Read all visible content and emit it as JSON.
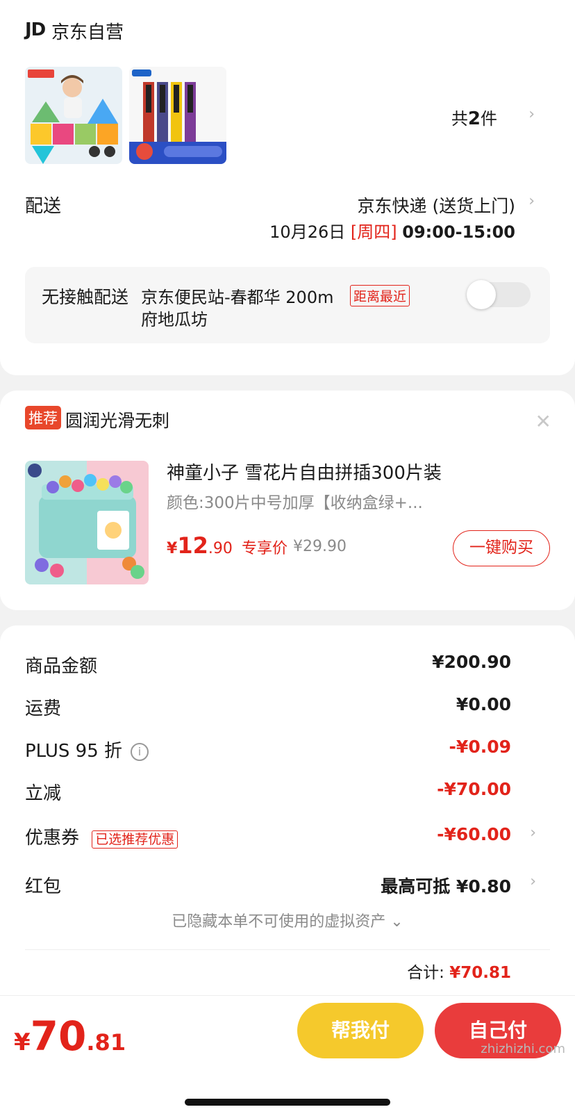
{
  "store": {
    "logo": "JD",
    "name": "京东自营"
  },
  "items_summary": {
    "prefix": "共",
    "count": "2",
    "suffix": "件"
  },
  "delivery": {
    "label": "配送",
    "method": "京东快递 (送货上门)",
    "date": "10月26日",
    "weekday": "[周四]",
    "time": "09:00-15:00"
  },
  "no_contact": {
    "label": "无接触配送",
    "station": "京东便民站-春都华 200m",
    "tag": "距离最近",
    "station_line2": "府地瓜坊"
  },
  "recommend": {
    "badge": "推荐",
    "title": "圆润光滑无刺",
    "product_name": "神童小子 雪花片自由拼插300片装",
    "spec": "颜色:300片中号加厚【收纳盒绿+...",
    "price_symbol": "¥",
    "price_int": "12",
    "price_dec": ".90",
    "price_label": "专享价",
    "original_price": "¥29.90",
    "buy_button": "一键购买"
  },
  "fees": {
    "goods": {
      "label": "商品金额",
      "value": "¥200.90"
    },
    "shipping": {
      "label": "运费",
      "value": "¥0.00"
    },
    "plus": {
      "label": "PLUS 95 折",
      "value": "-¥0.09"
    },
    "instant": {
      "label": "立减",
      "value": "-¥70.00"
    },
    "coupon": {
      "label": "优惠券",
      "tag": "已选推荐优惠",
      "value": "-¥60.00"
    },
    "redpacket": {
      "label": "红包",
      "value": "最高可抵 ¥0.80"
    },
    "hidden_note": "已隐藏本单不可使用的虚拟资产"
  },
  "total": {
    "label": "合计:",
    "value": "¥70.81"
  },
  "bottom": {
    "symbol": "¥",
    "int": "70",
    "dec": ".81",
    "help_pay": "帮我付",
    "self_pay": "自己付"
  },
  "watermark": "zhizhizhi.com",
  "colors": {
    "accent_red": "#e2231a",
    "help_yellow": "#f5c92c",
    "self_red": "#e93c3c"
  }
}
